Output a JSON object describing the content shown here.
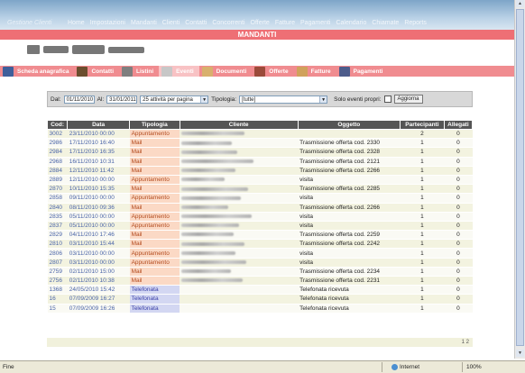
{
  "header": {
    "brand": "Gestione Clienti",
    "nav": [
      "Home",
      "Impostazioni",
      "Mandanti",
      "Clienti",
      "Contatti",
      "Concorrenti",
      "Offerte",
      "Fatture",
      "Pagamenti",
      "Calendario",
      "Chiamate",
      "Reports"
    ]
  },
  "page_title": "MANDANTI",
  "tabs": [
    {
      "label": "Scheda anagrafica",
      "color": "#3f5f9a"
    },
    {
      "label": "Contatti",
      "color": "#6b4e2e"
    },
    {
      "label": "Listini",
      "color": "#7f7f7f"
    },
    {
      "label": "Eventi",
      "color": "#c7c7c7"
    },
    {
      "label": "Documenti",
      "color": "#d8b06d"
    },
    {
      "label": "Offerte",
      "color": "#9b4b3a"
    },
    {
      "label": "Fatture",
      "color": "#d0a25c"
    },
    {
      "label": "Pagamenti",
      "color": "#4d5c8b"
    }
  ],
  "filter": {
    "dal_label": "Dal:",
    "dal_value": "01/11/2010",
    "al_label": "Al:",
    "al_value": "31/01/2011",
    "per_page": "25 attività per pagina",
    "tipologia_label": "Tipologia:",
    "tipologia_value": "[tutte]",
    "solo_label": "Solo eventi propri:",
    "aggiorna": "Aggiorna"
  },
  "table": {
    "headers": [
      "Cod:",
      "Data",
      "Tipologia",
      "Cliente",
      "Oggetto",
      "Partecipanti",
      "Allegati"
    ],
    "rows": [
      {
        "cod": "3002",
        "data": "23/11/2010 00:00",
        "tip": "Appuntamento",
        "tipkind": "app",
        "ogg": "",
        "part": "2",
        "all": "0"
      },
      {
        "cod": "2986",
        "data": "17/11/2010 16:40",
        "tip": "Mail",
        "tipkind": "mail",
        "ogg": "Trasmissione offerta cod. 2330",
        "part": "1",
        "all": "0"
      },
      {
        "cod": "2984",
        "data": "17/11/2010 16:35",
        "tip": "Mail",
        "tipkind": "mail",
        "ogg": "Trasmissione offerta cod. 2328",
        "part": "1",
        "all": "0"
      },
      {
        "cod": "2968",
        "data": "16/11/2010 10:31",
        "tip": "Mail",
        "tipkind": "mail",
        "ogg": "Trasmissione offerta cod. 2121",
        "part": "1",
        "all": "0"
      },
      {
        "cod": "2884",
        "data": "12/11/2010 11:42",
        "tip": "Mail",
        "tipkind": "mail",
        "ogg": "Trasmissione offerta cod. 2266",
        "part": "1",
        "all": "0"
      },
      {
        "cod": "2889",
        "data": "12/11/2010 00:00",
        "tip": "Appuntamento",
        "tipkind": "app",
        "ogg": "visita",
        "part": "1",
        "all": "0"
      },
      {
        "cod": "2870",
        "data": "10/11/2010 15:35",
        "tip": "Mail",
        "tipkind": "mail",
        "ogg": "Trasmissione offerta cod. 2285",
        "part": "1",
        "all": "0"
      },
      {
        "cod": "2858",
        "data": "09/11/2010 00:00",
        "tip": "Appuntamento",
        "tipkind": "app",
        "ogg": "visita",
        "part": "1",
        "all": "0"
      },
      {
        "cod": "2840",
        "data": "08/11/2010 09:36",
        "tip": "Mail",
        "tipkind": "mail",
        "ogg": "Trasmissione offerta cod. 2266",
        "part": "1",
        "all": "0"
      },
      {
        "cod": "2835",
        "data": "05/11/2010 00:00",
        "tip": "Appuntamento",
        "tipkind": "app",
        "ogg": "visita",
        "part": "1",
        "all": "0"
      },
      {
        "cod": "2837",
        "data": "05/11/2010 00:00",
        "tip": "Appuntamento",
        "tipkind": "app",
        "ogg": "visita",
        "part": "1",
        "all": "0"
      },
      {
        "cod": "2829",
        "data": "04/11/2010 17:46",
        "tip": "Mail",
        "tipkind": "mail",
        "ogg": "Trasmissione offerta cod. 2259",
        "part": "1",
        "all": "0"
      },
      {
        "cod": "2810",
        "data": "03/11/2010 15:44",
        "tip": "Mail",
        "tipkind": "mail",
        "ogg": "Trasmissione offerta cod. 2242",
        "part": "1",
        "all": "0"
      },
      {
        "cod": "2806",
        "data": "03/11/2010 00:00",
        "tip": "Appuntamento",
        "tipkind": "app",
        "ogg": "visita",
        "part": "1",
        "all": "0"
      },
      {
        "cod": "2807",
        "data": "03/11/2010 00:00",
        "tip": "Appuntamento",
        "tipkind": "app",
        "ogg": "visita",
        "part": "1",
        "all": "0"
      },
      {
        "cod": "2759",
        "data": "02/11/2010 15:00",
        "tip": "Mail",
        "tipkind": "mail",
        "ogg": "Trasmissione offerta cod. 2234",
        "part": "1",
        "all": "0"
      },
      {
        "cod": "2756",
        "data": "02/11/2010 10:38",
        "tip": "Mail",
        "tipkind": "mail",
        "ogg": "Trasmissione offerta cod. 2231",
        "part": "1",
        "all": "0"
      },
      {
        "cod": "1368",
        "data": "24/05/2010 15:42",
        "tip": "Telefonata",
        "tipkind": "tel",
        "ogg": "Telefonata ricevuta",
        "part": "1",
        "all": "0"
      },
      {
        "cod": "16",
        "data": "07/09/2009 16:27",
        "tip": "Telefonata",
        "tipkind": "tel",
        "ogg": "Telefonata ricevuta",
        "part": "1",
        "all": "0"
      },
      {
        "cod": "15",
        "data": "07/09/2009 16:26",
        "tip": "Telefonata",
        "tipkind": "tel",
        "ogg": "Telefonata ricevuta",
        "part": "1",
        "all": "0"
      }
    ]
  },
  "pager": "1 2",
  "status": {
    "left": "Fine",
    "zone": "Internet",
    "zoom": "100%"
  }
}
